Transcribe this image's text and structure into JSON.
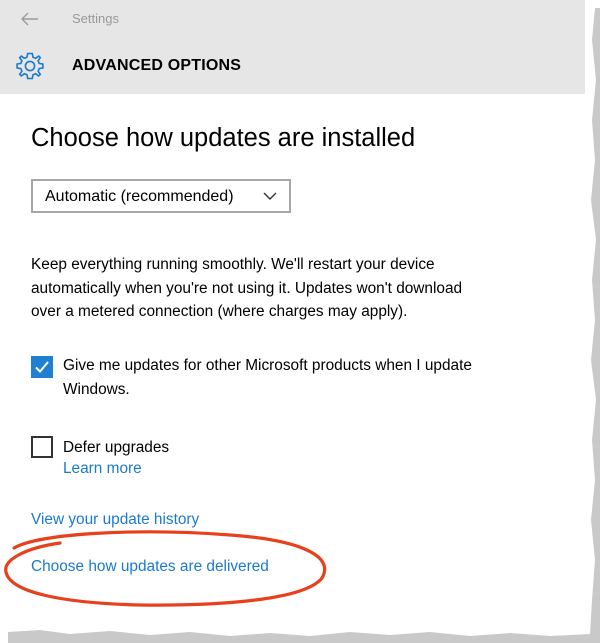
{
  "window": {
    "app_title": "Settings",
    "section_title": "ADVANCED OPTIONS"
  },
  "icons": {
    "back": "arrow-left-icon",
    "settings": "gear-icon",
    "dropdown": "chevron-down-icon",
    "check": "checkmark-icon"
  },
  "main": {
    "heading": "Choose how updates are installed",
    "dropdown": {
      "selected": "Automatic (recommended)"
    },
    "description_lines": [
      "Keep everything running smoothly. We'll restart your device",
      "automatically when you're not using it. Updates won't download",
      "over a metered connection (where charges may apply)."
    ],
    "options": [
      {
        "label_lines": [
          "Give me updates for other Microsoft products when I update",
          "Windows."
        ],
        "checked": true
      },
      {
        "label_lines": [
          "Defer upgrades"
        ],
        "checked": false,
        "link": "Learn more"
      }
    ],
    "links": {
      "history": "View your update history",
      "delivered": "Choose how updates are delivered"
    }
  },
  "colors": {
    "header_bg": "#e6e6e6",
    "accent": "#1e7fd4",
    "link": "#1a7ad0",
    "annotation": "#e8401c"
  }
}
